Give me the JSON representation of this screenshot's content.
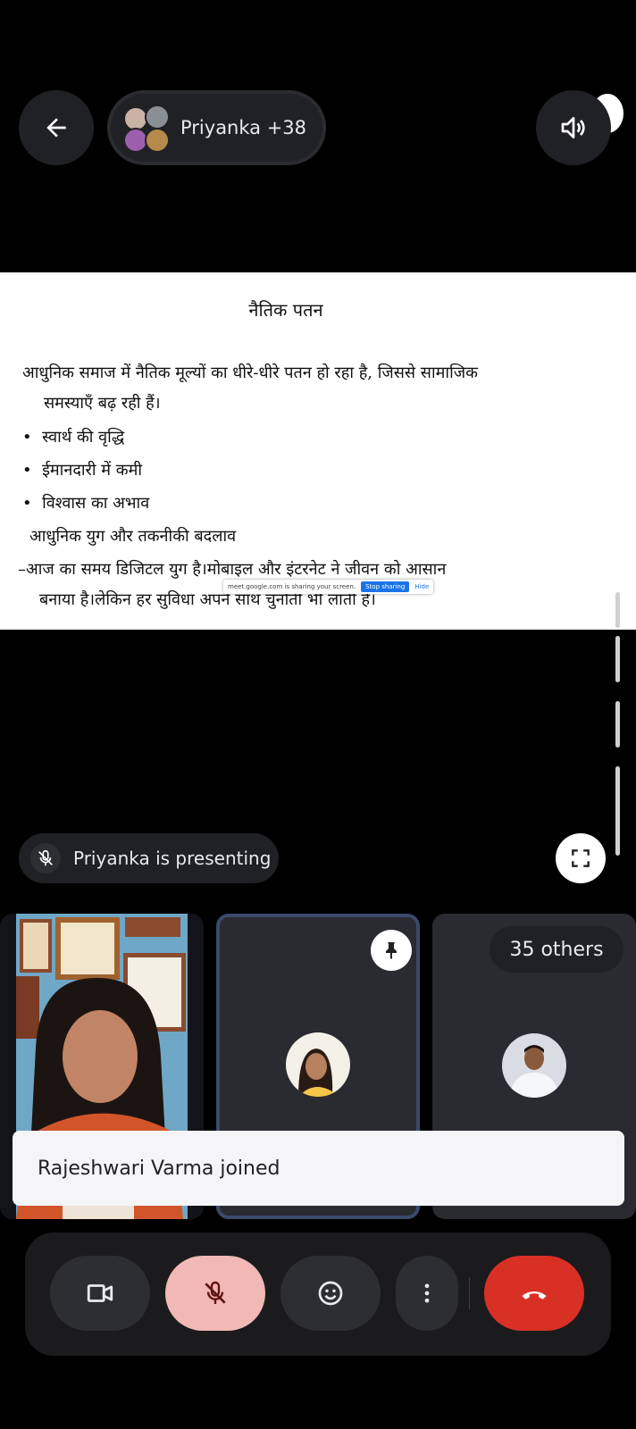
{
  "header": {
    "participants_label": "Priyanka +38"
  },
  "slide": {
    "title": "नैतिक पतन",
    "intro_line1": "आधुनिक समाज में नैतिक मूल्यों का धीरे-धीरे पतन हो रहा है, जिससे सामाजिक",
    "intro_line2": "समस्याएँ बढ़ रही हैं।",
    "bullets": [
      "स्वार्थ की वृद्धि",
      "ईमानदारी में कमी",
      "विश्वास का अभाव"
    ],
    "subheading": "आधुनिक युग और तकनीकी बदलाव",
    "para2_line1": "–आज का समय डिजिटल युग है।मोबाइल और इंटरनेट ने जीवन को आसान",
    "para2_line2": "बनाया है।लेकिन हर सुविधा अपने साथ चुनौती भी लाती है।",
    "share_bar_text": "meet.google.com is sharing your screen.",
    "stop_sharing_label": "Stop sharing",
    "hide_label": "Hide"
  },
  "presenting": {
    "label": "Priyanka is presenting"
  },
  "tiles": {
    "others_label": "35 others"
  },
  "toast": {
    "message": "Rajeshwari Varma joined"
  },
  "icons": {
    "back": "arrow-back-icon",
    "speaker": "volume-icon",
    "mic_off": "mic-off-icon",
    "fullscreen": "fullscreen-icon",
    "pin": "pin-icon",
    "video": "videocam-icon",
    "emoji": "emoji-icon",
    "more": "more-vert-icon",
    "hangup": "call-end-icon"
  },
  "colors": {
    "hangup": "#d93025",
    "mic_muted_bg": "#f2b8b5",
    "pinned_border": "#3b4a6b"
  }
}
